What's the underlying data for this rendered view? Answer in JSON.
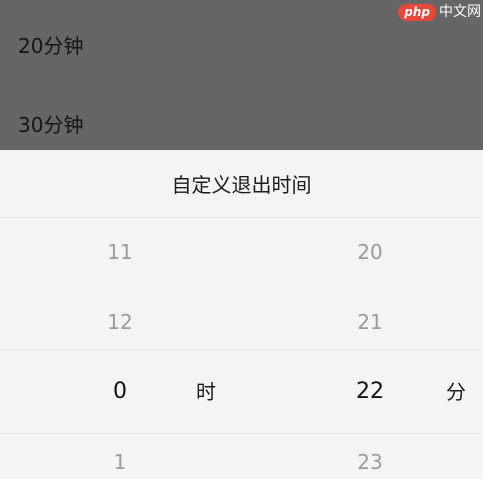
{
  "background_list": {
    "items": [
      "20分钟",
      "30分钟"
    ]
  },
  "watermark": {
    "logo": "php",
    "text": "中文网"
  },
  "dialog": {
    "title": "自定义退出时间",
    "hours": {
      "items": [
        "11",
        "12",
        "0",
        "1"
      ],
      "selected_index": 2,
      "unit": "时"
    },
    "minutes": {
      "items": [
        "20",
        "21",
        "22",
        "23"
      ],
      "selected_index": 2,
      "unit": "分"
    }
  }
}
